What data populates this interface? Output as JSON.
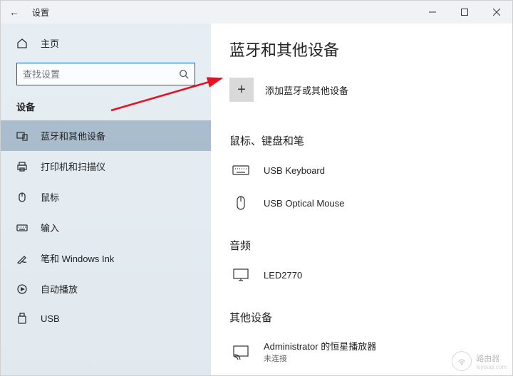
{
  "titlebar": {
    "title": "设置"
  },
  "sidebar": {
    "home_label": "主页",
    "search_placeholder": "查找设置",
    "section_label": "设备",
    "items": [
      {
        "label": "蓝牙和其他设备"
      },
      {
        "label": "打印机和扫描仪"
      },
      {
        "label": "鼠标"
      },
      {
        "label": "输入"
      },
      {
        "label": "笔和 Windows Ink"
      },
      {
        "label": "自动播放"
      },
      {
        "label": "USB"
      }
    ]
  },
  "content": {
    "page_title": "蓝牙和其他设备",
    "add_label": "添加蓝牙或其他设备",
    "sections": {
      "mouse_kb": {
        "heading": "鼠标、键盘和笔",
        "keyboard": "USB Keyboard",
        "mouse": "USB Optical Mouse"
      },
      "audio": {
        "heading": "音频",
        "device": "LED2770"
      },
      "other": {
        "heading": "其他设备",
        "device": "Administrator 的恒星播放器",
        "status": "未连接"
      }
    }
  },
  "watermark": {
    "brand": "路由器",
    "url": "luyouqi.com"
  }
}
